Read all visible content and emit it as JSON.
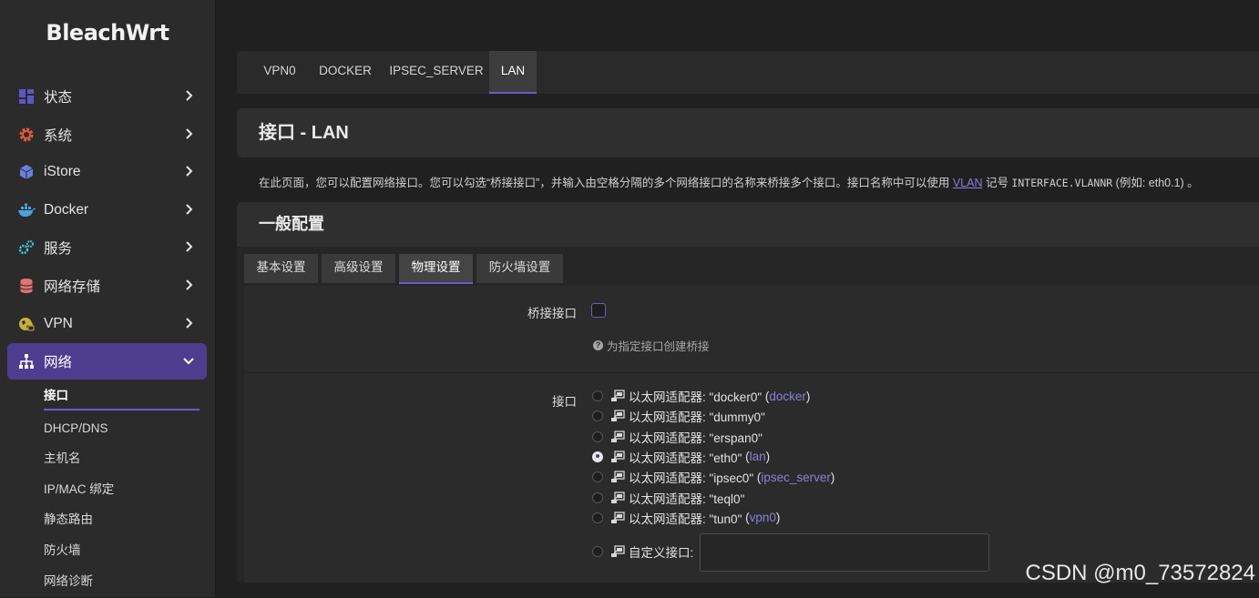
{
  "brand": "BleachWrt",
  "sidebar": {
    "items": [
      {
        "label": "状态",
        "icon": "dashboard-icon",
        "color": "#5b57c8"
      },
      {
        "label": "系统",
        "icon": "gear-icon",
        "color": "#e8573a"
      },
      {
        "label": "iStore",
        "icon": "cube-icon",
        "color": "#6a7fe0"
      },
      {
        "label": "Docker",
        "icon": "docker-icon",
        "color": "#4aa3df"
      },
      {
        "label": "服务",
        "icon": "cogs-icon",
        "color": "#3ec6d8"
      },
      {
        "label": "网络存储",
        "icon": "database-icon",
        "color": "#e57373"
      },
      {
        "label": "VPN",
        "icon": "globe-lock-icon",
        "color": "#c9b23a"
      },
      {
        "label": "网络",
        "icon": "sitemap-icon",
        "color": "#ffffff"
      }
    ],
    "subitems": [
      "接口",
      "DHCP/DNS",
      "主机名",
      "IP/MAC 绑定",
      "静态路由",
      "防火墙",
      "网络诊断"
    ]
  },
  "top_tabs": [
    "VPN0",
    "DOCKER",
    "IPSEC_SERVER",
    "LAN"
  ],
  "page": {
    "title": "接口 - LAN",
    "desc_pre": "在此页面，您可以配置网络接口。您可以勾选“桥接接口”，并输入由空格分隔的多个网络接口的名称来桥接多个接口。接口名称中可以使用 ",
    "desc_link": "VLAN",
    "desc_mid": " 记号 ",
    "desc_code": "INTERFACE.VLANNR",
    "desc_post": " (例如: eth0.1) 。"
  },
  "general": {
    "title": "一般配置",
    "tabs": [
      "基本设置",
      "高级设置",
      "物理设置",
      "防火墙设置"
    ]
  },
  "bridge": {
    "label": "桥接接口",
    "hint": "为指定接口创建桥接"
  },
  "iface": {
    "label": "接口",
    "options": [
      {
        "text": "以太网适配器: \"docker0\"",
        "net": "docker",
        "checked": false
      },
      {
        "text": "以太网适配器: \"dummy0\"",
        "net": "",
        "checked": false
      },
      {
        "text": "以太网适配器: \"erspan0\"",
        "net": "",
        "checked": false
      },
      {
        "text": "以太网适配器: \"eth0\"",
        "net": "lan",
        "checked": true
      },
      {
        "text": "以太网适配器: \"ipsec0\"",
        "net": "ipsec_server",
        "checked": false
      },
      {
        "text": "以太网适配器: \"teql0\"",
        "net": "",
        "checked": false
      },
      {
        "text": "以太网适配器: \"tun0\"",
        "net": "vpn0",
        "checked": false
      }
    ],
    "custom_label": "自定义接口:",
    "custom_value": ""
  },
  "watermark": "CSDN @m0_73572824"
}
